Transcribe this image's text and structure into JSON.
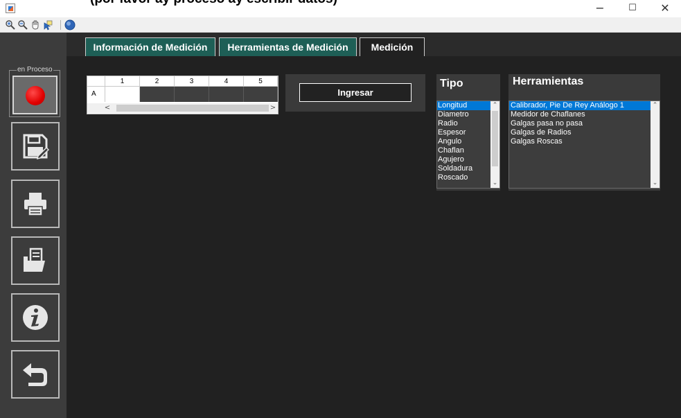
{
  "window": {
    "banner_text": "(por favor ay proceso ay escribir datos)",
    "minimize": "−",
    "maximize": "☐",
    "close": "✕"
  },
  "toolbar": {
    "icons": [
      "zoom-in-icon",
      "zoom-out-icon",
      "pan-hand-icon",
      "data-cursor-icon",
      "help-icon"
    ]
  },
  "tabs": [
    {
      "label": "Información de Medición",
      "active": false
    },
    {
      "label": "Herramientas de Medición",
      "active": false
    },
    {
      "label": "Medición",
      "active": true
    }
  ],
  "sidebar": {
    "status_label": "en Proceso",
    "status_color": "#e00000",
    "buttons": [
      "save-icon",
      "print-icon",
      "open-folder-icon",
      "info-icon",
      "back-arrow-icon"
    ]
  },
  "table": {
    "columns": [
      "1",
      "2",
      "3",
      "4",
      "5"
    ],
    "rows": [
      "A"
    ],
    "scroll_left": "<",
    "scroll_right": ">"
  },
  "ingresar": {
    "label": "Ingresar"
  },
  "tipo": {
    "title": "Tipo",
    "selected": "Longitud",
    "items": [
      "Longitud",
      "Diametro",
      "Radio",
      "Espesor",
      "Angulo",
      "Chaflan",
      "Agujero",
      "Soldadura",
      "Roscado"
    ]
  },
  "herramientas": {
    "title": "Herramientas",
    "selected": "Calibrador, Pie De Rey Análogo 1",
    "items": [
      "Calibrador, Pie De Rey Análogo 1",
      "Medidor de Chaflanes",
      "Galgas pasa no pasa",
      "Galgas de Radios",
      "Galgas Roscas"
    ]
  },
  "colors": {
    "tab_bg": "#1e5f56",
    "selection": "#0078d7",
    "panel_bg": "#3a3a3a",
    "content_bg": "#212121"
  }
}
